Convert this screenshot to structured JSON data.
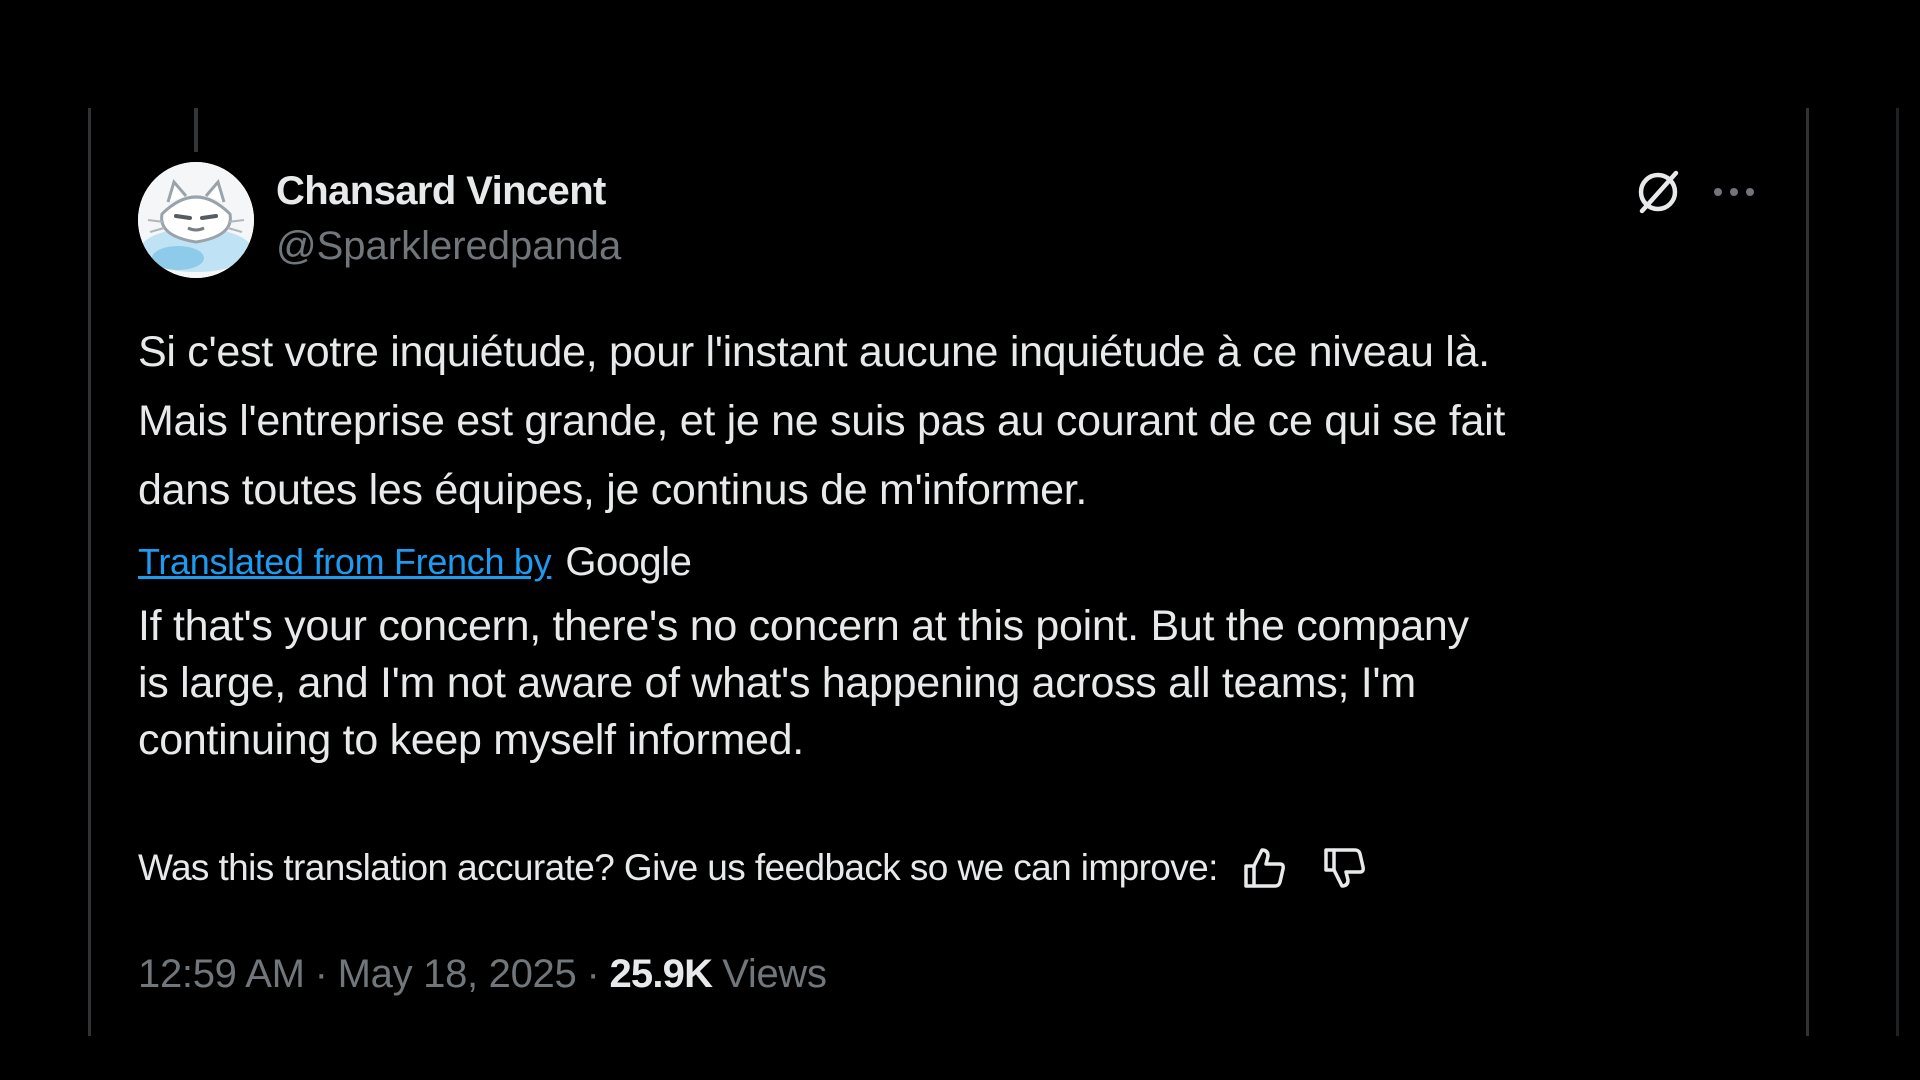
{
  "tweet": {
    "author": {
      "display_name": "Chansard Vincent",
      "handle": "@Sparkleredpanda"
    },
    "original_text_lines": [
      "Si c'est votre inquiétude, pour l'instant aucune inquiétude à ce niveau là.",
      "Mais l'entreprise est grande, et je ne suis pas au courant de ce qui se fait",
      "dans toutes les équipes, je continus de m'informer."
    ],
    "translation": {
      "label": "Translated from French by",
      "provider": "Google",
      "text_lines": [
        "If that's your concern, there's no concern at this point. But the company",
        "is large, and I'm not aware of what's happening across all teams; I'm",
        "continuing to keep myself informed."
      ]
    },
    "feedback": {
      "prompt": "Was this translation accurate? Give us feedback so we can improve:",
      "thumbs_up_icon": "thumbs-up-icon",
      "thumbs_down_icon": "thumbs-down-icon"
    },
    "meta": {
      "time": "12:59 AM",
      "separator": "·",
      "date": "May 18, 2025",
      "views_count": "25.9K",
      "views_label": "Views"
    }
  },
  "icons": {
    "grok": "grok-icon",
    "more": "more-options-icon"
  },
  "colors": {
    "background": "#000000",
    "text_primary": "#e7e9ea",
    "text_secondary": "#71767b",
    "link": "#1d9bf0",
    "border": "#2f3336"
  }
}
